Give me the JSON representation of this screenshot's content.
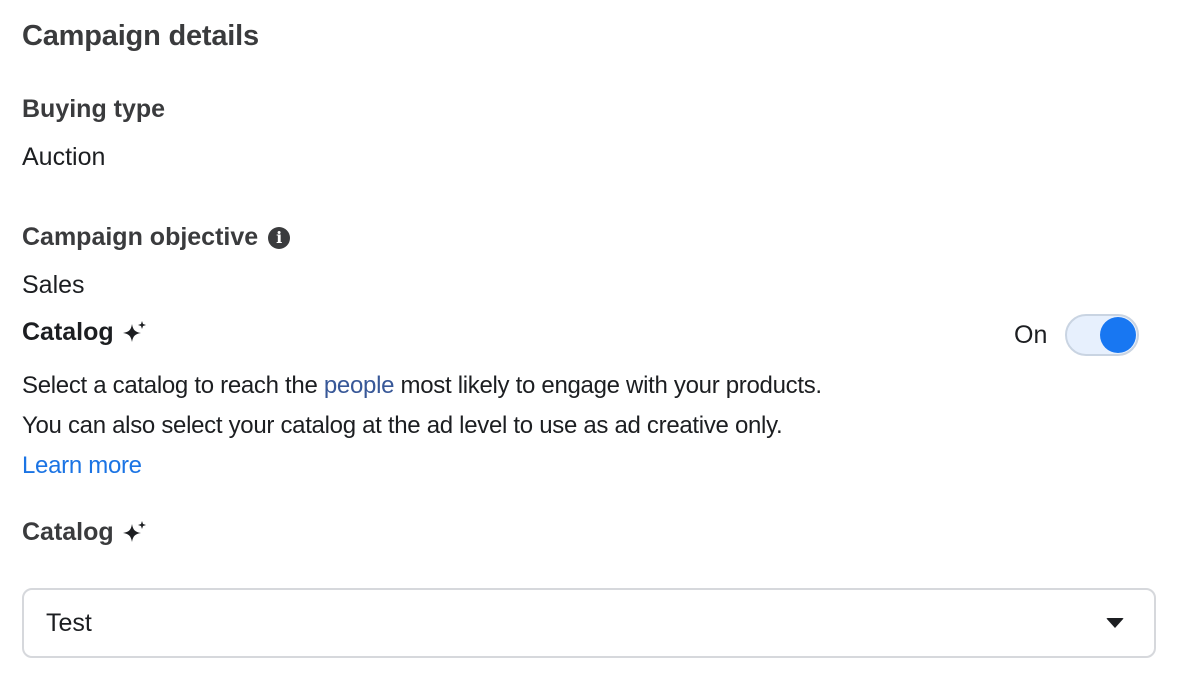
{
  "section": {
    "title": "Campaign details"
  },
  "buying_type": {
    "label": "Buying type",
    "value": "Auction"
  },
  "campaign_objective": {
    "label": "Campaign objective",
    "info_icon": "info-icon",
    "value": "Sales"
  },
  "catalog_toggle": {
    "label": "Catalog",
    "icon": "sparkle-icon",
    "state_label": "On",
    "enabled": true,
    "accent_color": "#1877f2",
    "description_part1": "Select a catalog to reach the ",
    "description_link": "people",
    "description_part2": " most likely to engage with your products.",
    "description_line2": "You can also select your catalog at the ad level to use as ad creative only.",
    "learn_more": "Learn more"
  },
  "catalog_select": {
    "label": "Catalog",
    "icon": "sparkle-icon",
    "selected_value": "Test",
    "caret_icon": "caret-down-icon"
  }
}
